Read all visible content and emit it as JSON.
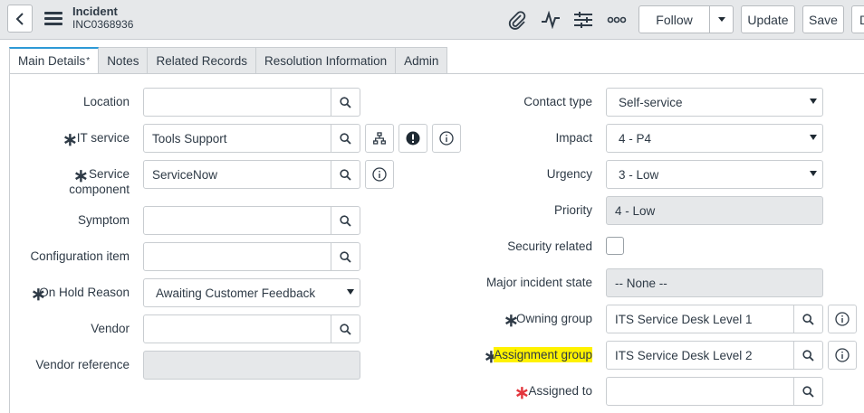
{
  "header": {
    "title": "Incident",
    "number": "INC0368936",
    "follow_label": "Follow",
    "update_label": "Update",
    "save_label": "Save",
    "more_label": "D"
  },
  "tabs": [
    {
      "label": "Main Details",
      "active": true,
      "modified_marker": "*"
    },
    {
      "label": "Notes"
    },
    {
      "label": "Related Records"
    },
    {
      "label": "Resolution Information"
    },
    {
      "label": "Admin"
    }
  ],
  "left_fields": {
    "location": {
      "label": "Location",
      "value": ""
    },
    "it_service": {
      "label": "IT service",
      "value": "Tools Support"
    },
    "service_component": {
      "label_line1": "Service",
      "label_line2": "component",
      "value": "ServiceNow"
    },
    "symptom": {
      "label": "Symptom",
      "value": ""
    },
    "configuration_item": {
      "label": "Configuration item",
      "value": ""
    },
    "on_hold_reason": {
      "label": "On Hold Reason",
      "value": "Awaiting Customer Feedback"
    },
    "vendor": {
      "label": "Vendor",
      "value": ""
    },
    "vendor_reference": {
      "label": "Vendor reference",
      "value": ""
    }
  },
  "right_fields": {
    "contact_type": {
      "label": "Contact type",
      "value": "Self-service"
    },
    "impact": {
      "label": "Impact",
      "value": "4 - P4"
    },
    "urgency": {
      "label": "Urgency",
      "value": "3 - Low"
    },
    "priority": {
      "label": "Priority",
      "value": "4 - Low"
    },
    "security_related": {
      "label": "Security related",
      "checked": false
    },
    "major_incident_state": {
      "label": "Major incident state",
      "value": "-- None --"
    },
    "owning_group": {
      "label": "Owning group",
      "value": "ITS Service Desk Level 1"
    },
    "assignment_group": {
      "label": "Assignment group",
      "value": "ITS Service Desk Level 2"
    },
    "assigned_to": {
      "label": "Assigned to",
      "value": ""
    }
  },
  "required_marker": "∗",
  "colors": {
    "header_bg": "#e6e8ea",
    "active_tab_accent": "#2e9ad6",
    "mandatory_red": "#e3363d",
    "highlight": "#fff200"
  }
}
